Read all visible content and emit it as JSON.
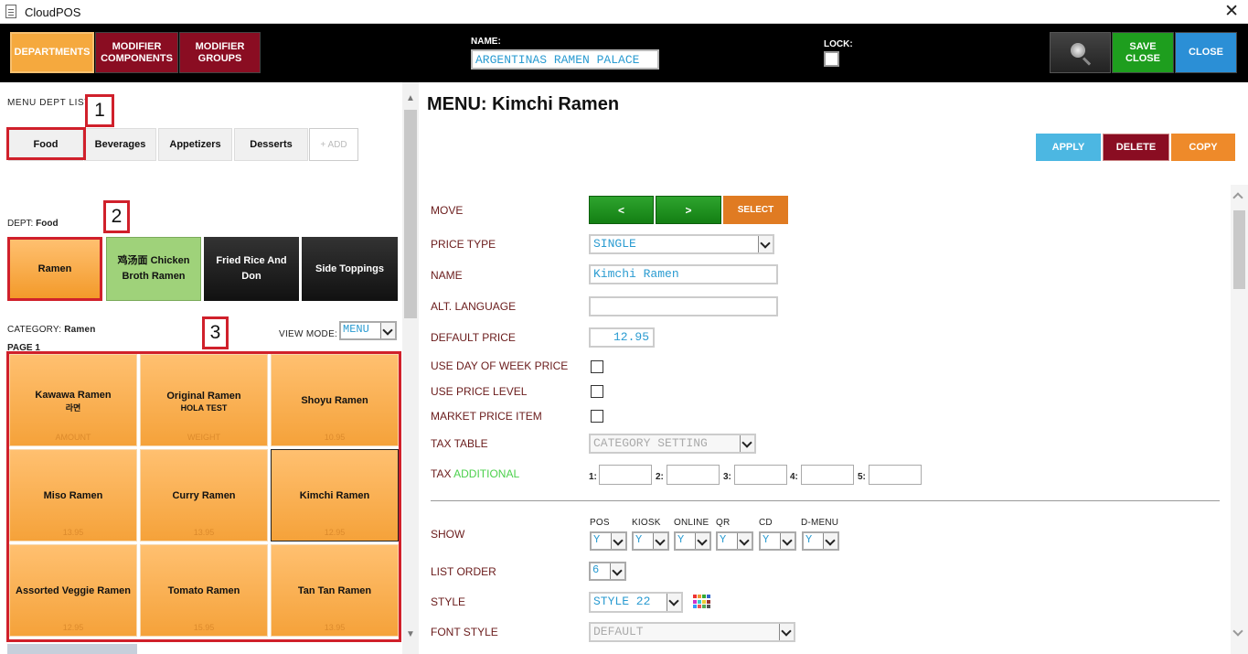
{
  "window": {
    "title": "CloudPOS",
    "close_label": "✕"
  },
  "topbar": {
    "tabs": [
      {
        "label": "DEPARTMENTS"
      },
      {
        "label": "MODIFIER COMPONENTS"
      },
      {
        "label": "MODIFIER GROUPS"
      }
    ],
    "name_label": "NAME:",
    "name_value": "ARGENTINAS RAMEN PALACE",
    "lock_label": "LOCK:",
    "lock_checked": false,
    "search_icon": "magnifier-icon",
    "save_close_label": "SAVE CLOSE",
    "close_label": "CLOSE"
  },
  "left": {
    "menu_dept_list_label": "MENU DEPT LIST",
    "markers": [
      "1",
      "2",
      "3"
    ],
    "departments": [
      {
        "label": "Food",
        "selected": true
      },
      {
        "label": "Beverages"
      },
      {
        "label": "Appetizers"
      },
      {
        "label": "Desserts"
      }
    ],
    "add_label": "+ ADD",
    "dept_label": "DEPT:",
    "dept_value": "Food",
    "categories": [
      {
        "label": "Ramen",
        "color": "#f39a2a",
        "selected": true
      },
      {
        "label": "鸡汤面 Chicken Broth Ramen",
        "color": "#9fd27a"
      },
      {
        "label": "Fried Rice And Don",
        "color": "#1a1a1a"
      },
      {
        "label": "Side Toppings",
        "color": "#1a1a1a"
      }
    ],
    "category_label": "CATEGORY:",
    "category_value": "Ramen",
    "view_mode_label": "VIEW MODE:",
    "view_mode_value": "MENU",
    "page_label": "PAGE 1",
    "items": [
      {
        "name": "Kawawa Ramen",
        "sub": "라면",
        "price": "AMOUNT"
      },
      {
        "name": "Original Ramen",
        "sub": "HOLA TEST",
        "price": "WEIGHT"
      },
      {
        "name": "Shoyu Ramen",
        "sub": "",
        "price": "10.95"
      },
      {
        "name": "Miso Ramen",
        "sub": "",
        "price": "13.95"
      },
      {
        "name": "Curry Ramen",
        "sub": "",
        "price": "13.95"
      },
      {
        "name": "Kimchi Ramen",
        "sub": "",
        "price": "12.95",
        "selected": true
      },
      {
        "name": "Assorted Veggie Ramen",
        "sub": "",
        "price": "12.95"
      },
      {
        "name": "Tomato Ramen",
        "sub": "",
        "price": "15.95"
      },
      {
        "name": "Tan Tan Ramen",
        "sub": "",
        "price": "13.95"
      }
    ]
  },
  "right": {
    "menu_title": "MENU: Kimchi Ramen",
    "apply_label": "APPLY",
    "delete_label": "DELETE",
    "copy_label": "COPY",
    "fields": {
      "move_label": "MOVE",
      "move_prev": "<",
      "move_next": ">",
      "move_select": "SELECT",
      "price_type_label": "PRICE TYPE",
      "price_type_value": "SINGLE",
      "name_label": "NAME",
      "name_value": "Kimchi Ramen",
      "alt_language_label": "ALT. LANGUAGE",
      "alt_language_value": "",
      "default_price_label": "DEFAULT PRICE",
      "default_price_value": "12.95",
      "use_dow_price_label": "USE DAY OF WEEK PRICE",
      "use_price_level_label": "USE PRICE LEVEL",
      "market_price_label": "MARKET PRICE ITEM",
      "tax_table_label": "TAX TABLE",
      "tax_table_value": "CATEGORY SETTING",
      "tax_label": "TAX",
      "tax_additional": "ADDITIONAL",
      "tax_slots": [
        "1:",
        "2:",
        "3:",
        "4:",
        "5:"
      ],
      "show_label": "SHOW",
      "show_columns": [
        {
          "label": "POS",
          "value": "Y"
        },
        {
          "label": "KIOSK",
          "value": "Y"
        },
        {
          "label": "ONLINE",
          "value": "Y"
        },
        {
          "label": "QR",
          "value": "Y"
        },
        {
          "label": "CD",
          "value": "Y"
        },
        {
          "label": "D-MENU",
          "value": "Y"
        }
      ],
      "list_order_label": "LIST ORDER",
      "list_order_value": "6",
      "style_label": "STYLE",
      "style_value": "STYLE 22",
      "style_icon": "color-grid-icon",
      "font_style_label": "FONT STYLE",
      "font_style_value": "DEFAULT"
    }
  }
}
